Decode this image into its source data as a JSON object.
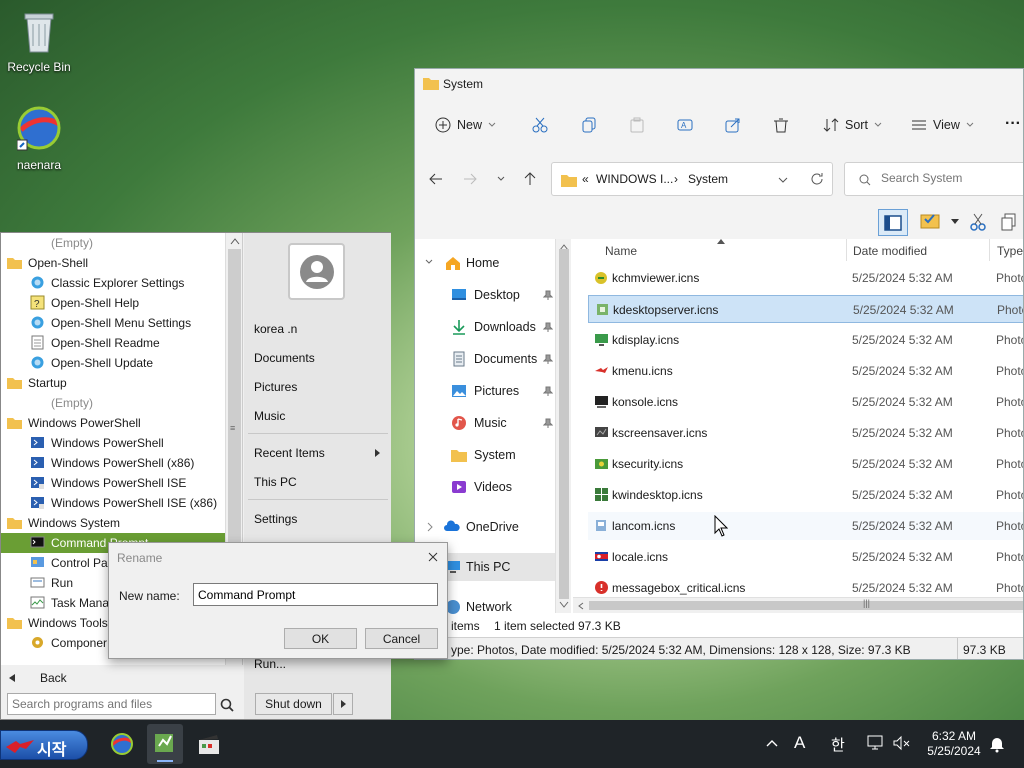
{
  "desktop": {
    "icons": [
      {
        "label": "Recycle Bin",
        "icon": "recycle-bin-icon"
      },
      {
        "label": "naenara",
        "icon": "naenara-globe-icon"
      }
    ]
  },
  "explorer": {
    "title": "System",
    "toolbar": {
      "new_label": "New",
      "sort_label": "Sort",
      "view_label": "View",
      "more_label": "···"
    },
    "address": {
      "prefix": "«",
      "crumb1": "WINDOWS I...",
      "separator": "›",
      "crumb2": "System"
    },
    "search": {
      "placeholder": "Search System"
    },
    "nav": {
      "home": "Home",
      "desktop": "Desktop",
      "downloads": "Downloads",
      "documents": "Documents",
      "pictures": "Pictures",
      "music": "Music",
      "system": "System",
      "videos": "Videos",
      "onedrive": "OneDrive",
      "thispc": "This PC",
      "network": "Network"
    },
    "columns": {
      "name": "Name",
      "date": "Date modified",
      "type": "Type"
    },
    "files": [
      {
        "name": "kchmviewer.icns",
        "date": "5/25/2024 5:32 AM",
        "type": "Photos"
      },
      {
        "name": "kdesktopserver.icns",
        "date": "5/25/2024 5:32 AM",
        "type": "Photos"
      },
      {
        "name": "kdisplay.icns",
        "date": "5/25/2024 5:32 AM",
        "type": "Photos"
      },
      {
        "name": "kmenu.icns",
        "date": "5/25/2024 5:32 AM",
        "type": "Photos"
      },
      {
        "name": "konsole.icns",
        "date": "5/25/2024 5:32 AM",
        "type": "Photos"
      },
      {
        "name": "kscreensaver.icns",
        "date": "5/25/2024 5:32 AM",
        "type": "Photos"
      },
      {
        "name": "ksecurity.icns",
        "date": "5/25/2024 5:32 AM",
        "type": "Photos"
      },
      {
        "name": "kwindesktop.icns",
        "date": "5/25/2024 5:32 AM",
        "type": "Photos"
      },
      {
        "name": "lancom.icns",
        "date": "5/25/2024 5:32 AM",
        "type": "Photos"
      },
      {
        "name": "locale.icns",
        "date": "5/25/2024 5:32 AM",
        "type": "Photos"
      },
      {
        "name": "messagebox_critical.icns",
        "date": "5/25/2024 5:32 AM",
        "type": "Photos"
      }
    ],
    "status": {
      "items": "items",
      "selected": "1 item selected",
      "size": "97.3 KB",
      "details": "ype: Photos, Date modified: 5/25/2024 5:32 AM, Dimensions: 128 x 128, Size: 97.3 KB",
      "details_size": "97.3 KB"
    }
  },
  "startmenu": {
    "programs": [
      {
        "label": "(Empty)",
        "indent": 2,
        "icon": "none"
      },
      {
        "label": "Open-Shell",
        "indent": 1,
        "icon": "folder-icon"
      },
      {
        "label": "Classic Explorer Settings",
        "indent": 2,
        "icon": "shell-icon"
      },
      {
        "label": "Open-Shell Help",
        "indent": 2,
        "icon": "help-icon"
      },
      {
        "label": "Open-Shell Menu Settings",
        "indent": 2,
        "icon": "shell-icon"
      },
      {
        "label": "Open-Shell Readme",
        "indent": 2,
        "icon": "document-icon"
      },
      {
        "label": "Open-Shell Update",
        "indent": 2,
        "icon": "shell-icon"
      },
      {
        "label": "Startup",
        "indent": 1,
        "icon": "folder-icon"
      },
      {
        "label": "(Empty)",
        "indent": 2,
        "icon": "none"
      },
      {
        "label": "Windows PowerShell",
        "indent": 1,
        "icon": "folder-icon"
      },
      {
        "label": "Windows PowerShell",
        "indent": 2,
        "icon": "powershell-icon"
      },
      {
        "label": "Windows PowerShell (x86)",
        "indent": 2,
        "icon": "powershell-icon"
      },
      {
        "label": "Windows PowerShell ISE",
        "indent": 2,
        "icon": "powershell-ise-icon"
      },
      {
        "label": "Windows PowerShell ISE (x86)",
        "indent": 2,
        "icon": "powershell-ise-icon"
      },
      {
        "label": "Windows System",
        "indent": 1,
        "icon": "folder-icon"
      },
      {
        "label": "Command Prompt",
        "indent": 2,
        "icon": "cmd-icon",
        "selected": true
      },
      {
        "label": "Control Pa",
        "indent": 2,
        "icon": "control-panel-icon"
      },
      {
        "label": "Run",
        "indent": 2,
        "icon": "run-icon"
      },
      {
        "label": "Task Manag",
        "indent": 2,
        "icon": "task-manager-icon"
      },
      {
        "label": "Windows Tools",
        "indent": 1,
        "icon": "folder-icon"
      },
      {
        "label": "Componer",
        "indent": 2,
        "icon": "component-icon"
      }
    ],
    "back_label": "Back",
    "search_placeholder": "Search programs and files",
    "right": {
      "user": "korea .n",
      "documents": "Documents",
      "pictures": "Pictures",
      "music": "Music",
      "recent": "Recent Items",
      "thispc": "This PC",
      "settings": "Settings",
      "run": "Run...",
      "shutdown": "Shut down"
    }
  },
  "dialog": {
    "title": "Rename",
    "field_label": "New name:",
    "value": "Command Prompt",
    "ok": "OK",
    "cancel": "Cancel"
  },
  "taskbar": {
    "start_label": "시작",
    "tray": {
      "ime_letter": "A",
      "ime_lang": "한",
      "time": "6:32 AM",
      "date": "5/25/2024"
    }
  }
}
